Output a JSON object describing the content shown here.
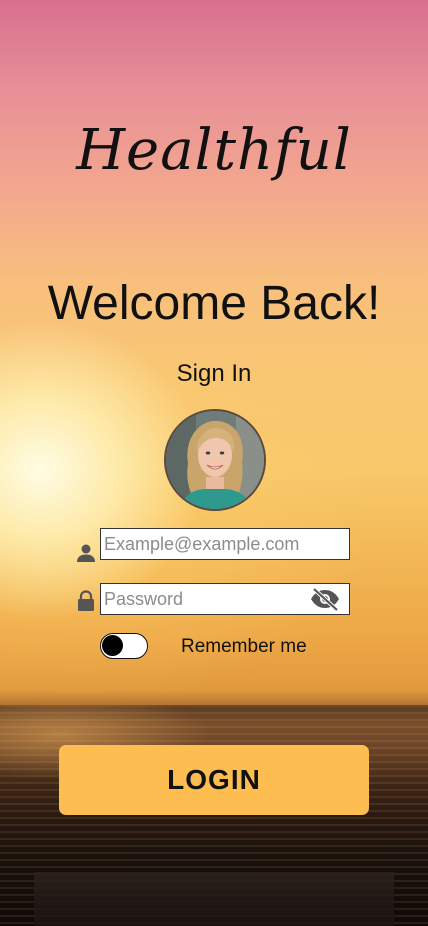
{
  "app": {
    "title": "Healthful"
  },
  "heading": {
    "welcome": "Welcome Back!",
    "subtitle": "Sign In"
  },
  "login_form": {
    "email": {
      "value": "",
      "placeholder": "Example@example.com",
      "icon": "user-icon"
    },
    "password": {
      "value": "",
      "placeholder": "Password",
      "icon": "lock-icon",
      "visibility_icon": "eye-off-icon"
    },
    "remember_me": {
      "label": "Remember me",
      "checked": false
    },
    "submit_label": "LOGIN"
  },
  "colors": {
    "button": "#fdbd50",
    "input_bg": "#ffffff",
    "text": "#111111"
  }
}
